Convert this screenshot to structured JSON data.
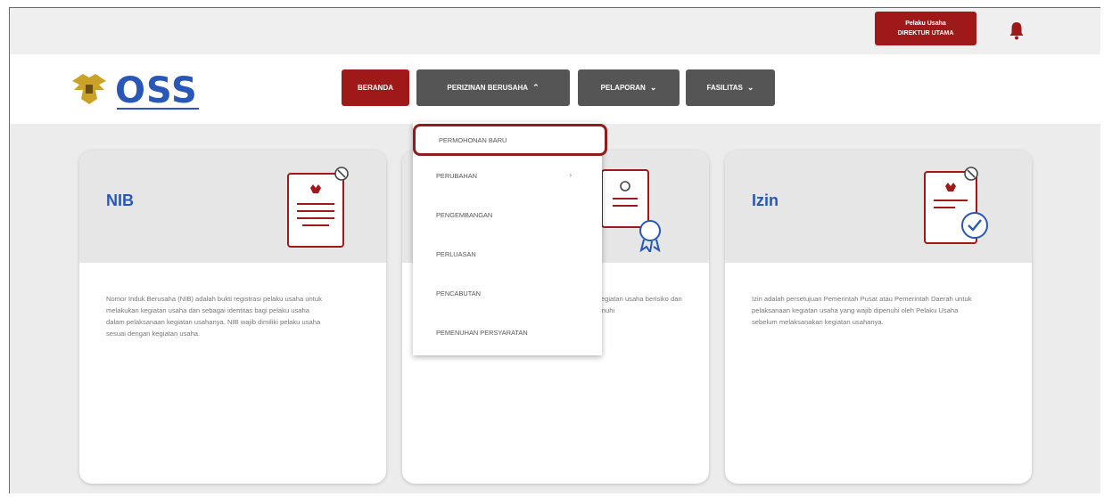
{
  "topbar": {
    "user_line1": "Pelaku Usaha",
    "user_line2": "DIREKTUR UTAMA"
  },
  "logo": {
    "text": "OSS"
  },
  "nav": {
    "beranda": "BERANDA",
    "perizinan": "PERIZINAN BERUSAHA",
    "pelaporan": "PELAPORAN",
    "fasilitas": "FASILITAS"
  },
  "dropdown": {
    "items": [
      "PERMOHONAN BARU",
      "PERUBAHAN",
      "PENGEMBANGAN",
      "PERLUASAN",
      "PENCABUTAN",
      "PEMENUHAN PERSYARATAN"
    ],
    "arrow": "›"
  },
  "cards": {
    "nib": {
      "title": "NIB",
      "text": "Nomor Induk Berusaha (NIB) adalah bukti registrasi pelaku usaha untuk melakukan kegiatan usaha dan sebagai identitas bagi pelaku usaha dalam pelaksanaan kegiatan usahanya. NIB wajib dimiliki pelaku usaha sesuai dengan kegiatan usaha."
    },
    "middle": {
      "text": "...dalam kegiatan usaha berisiko dan wajib dipenuhi"
    },
    "izin": {
      "title": "Izin",
      "text": "Izin adalah persetujuan Pemerintah Pusat atau Pemerintah Daerah untuk pelaksanaan kegiatan usaha yang wajib dipenuhi oleh Pelaku Usaha sebelum melaksanakan kegiatan usahanya."
    }
  },
  "colors": {
    "brand_red": "#a01919",
    "nav_dark": "#555555",
    "title_blue": "#2857b8"
  }
}
